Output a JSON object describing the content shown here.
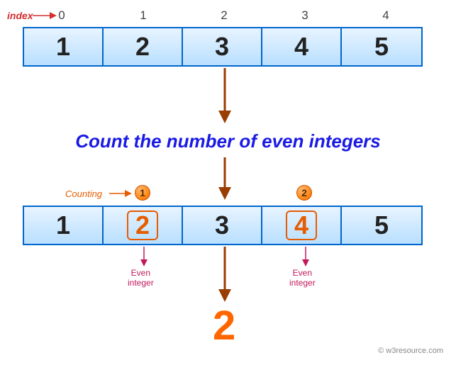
{
  "labels": {
    "index": "index",
    "counting": "Counting",
    "even_integer_1": "Even\ninteger",
    "even_integer_2": "Even\ninteger",
    "credit": "© w3resource.com"
  },
  "title": "Count the number of even integers",
  "indices": [
    "0",
    "1",
    "2",
    "3",
    "4"
  ],
  "array1": [
    "1",
    "2",
    "3",
    "4",
    "5"
  ],
  "array2": [
    "1",
    "2",
    "3",
    "4",
    "5"
  ],
  "badges": [
    "1",
    "2"
  ],
  "result": "2"
}
